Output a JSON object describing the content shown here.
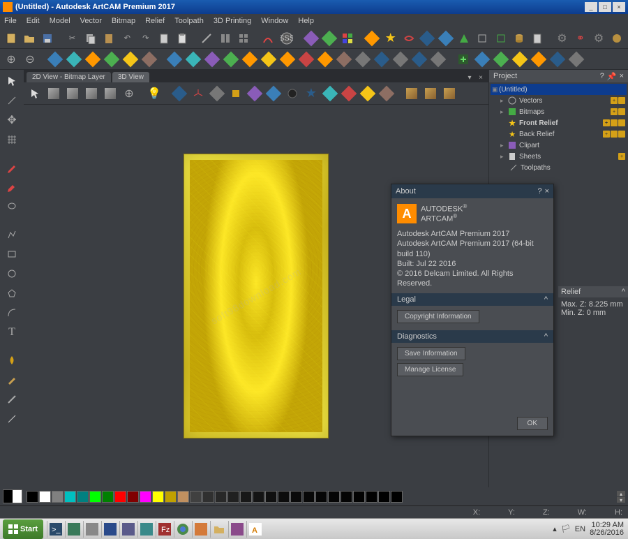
{
  "titlebar": {
    "text": "(Untitled) - Autodesk ArtCAM Premium 2017"
  },
  "menu": [
    "File",
    "Edit",
    "Model",
    "Vector",
    "Bitmap",
    "Relief",
    "Toolpath",
    "3D Printing",
    "Window",
    "Help"
  ],
  "view_tabs": {
    "tab1": "2D View - Bitmap Layer",
    "tab2": "3D View"
  },
  "project_panel": {
    "title": "Project",
    "tree": {
      "root": "(Untitled)",
      "items": [
        "Vectors",
        "Bitmaps",
        "Front Relief",
        "Back Relief",
        "Clipart",
        "Sheets",
        "Toolpaths"
      ]
    }
  },
  "relief_info": {
    "name": "Relief",
    "max": "Max. Z: 8.225 mm",
    "min": "Min. Z: 0 mm"
  },
  "about": {
    "title": "About",
    "brand1": "AUTODESK",
    "brand2": "ARTCAM",
    "line1": "Autodesk ArtCAM Premium 2017",
    "line2": "Autodesk ArtCAM Premium 2017 (64-bit build 110)",
    "line3": "Built: Jul 22 2016",
    "line4": "© 2016 Delcam Limited. All Rights Reserved.",
    "legal": "Legal",
    "copyright_btn": "Copyright Information",
    "diagnostics": "Diagnostics",
    "save_btn": "Save Information",
    "license_btn": "Manage License",
    "ok": "OK"
  },
  "status": {
    "x": "X:",
    "y": "Y:",
    "z": "Z:",
    "w": "W:",
    "h": "H:"
  },
  "colors": [
    "#000000",
    "#ffffff",
    "#808080",
    "#00c0c0",
    "#008080",
    "#00ff00",
    "#008000",
    "#ff0000",
    "#800000",
    "#ff00ff",
    "#ffff00",
    "#c0a000",
    "#c09060",
    "#404040",
    "#303030",
    "#282828",
    "#202020",
    "#181818",
    "#141414",
    "#101010",
    "#0c0c0c",
    "#0a0a0a",
    "#080808",
    "#060606",
    "#050505",
    "#040404",
    "#030303",
    "#020202",
    "#010101",
    "#000000"
  ],
  "taskbar": {
    "start": "Start",
    "lang": "EN",
    "time": "10:29 AM",
    "date": "8/26/2016"
  }
}
